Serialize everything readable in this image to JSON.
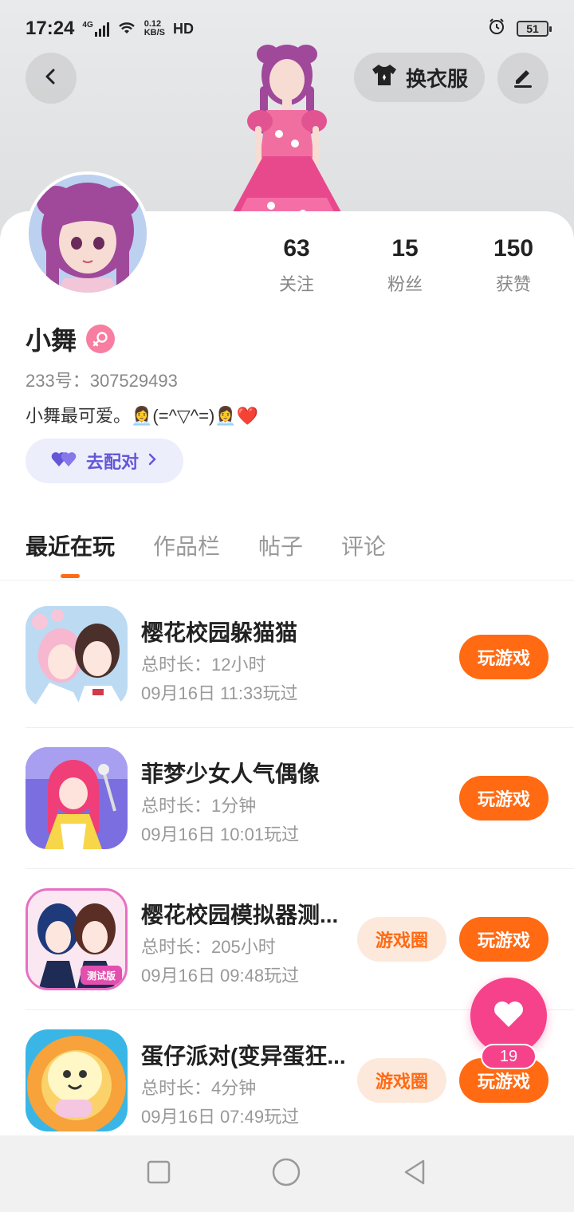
{
  "status_bar": {
    "time": "17:24",
    "network": "4G",
    "speed_value": "0.12",
    "speed_unit": "KB/S",
    "hd": "HD",
    "battery": "51"
  },
  "header": {
    "dress_up_label": "换衣服"
  },
  "profile": {
    "name": "小舞",
    "uid_text": "233号：307529493",
    "bio": "小舞最可爱。👩‍💼(=^▽^=)👩‍💼❤️",
    "match_label": "去配对",
    "stats": [
      {
        "value": "63",
        "label": "关注"
      },
      {
        "value": "15",
        "label": "粉丝"
      },
      {
        "value": "150",
        "label": "获赞"
      }
    ]
  },
  "tabs": [
    "最近在玩",
    "作品栏",
    "帖子",
    "评论"
  ],
  "games": [
    {
      "title": "樱花校园躲猫猫",
      "duration": "总时长：12小时",
      "played": "09月16日 11:33玩过",
      "play_label": "玩游戏",
      "circle_label": ""
    },
    {
      "title": "菲梦少女人气偶像",
      "duration": "总时长：1分钟",
      "played": "09月16日 10:01玩过",
      "play_label": "玩游戏",
      "circle_label": ""
    },
    {
      "title": "樱花校园模拟器测...",
      "duration": "总时长：205小时",
      "played": "09月16日 09:48玩过",
      "play_label": "玩游戏",
      "circle_label": "游戏圈",
      "icon_badge": "测试版"
    },
    {
      "title": "蛋仔派对(变异蛋狂...",
      "duration": "总时长：4分钟",
      "played": "09月16日 07:49玩过",
      "play_label": "玩游戏",
      "circle_label": "游戏圈"
    }
  ],
  "fab": {
    "count": "19"
  },
  "colors": {
    "accent": "#ff6a13",
    "pink": "#f5428b",
    "match": "#6456d8"
  }
}
